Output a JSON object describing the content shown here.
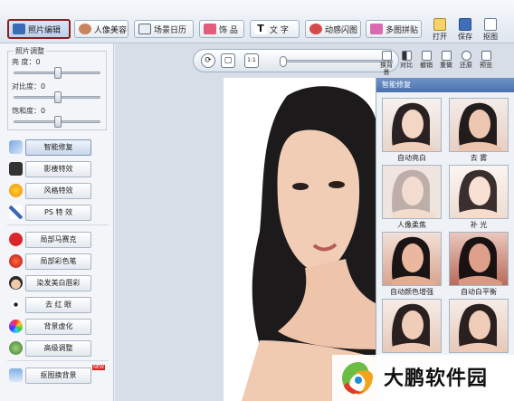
{
  "toolbar": {
    "tabs": [
      {
        "label": "照片编辑",
        "icon": "photo-edit-icon",
        "active": true
      },
      {
        "label": "人像美容",
        "icon": "portrait-icon",
        "active": false
      },
      {
        "label": "场景日历",
        "icon": "calendar-icon",
        "active": false
      },
      {
        "label": "饰 品",
        "icon": "accessory-icon",
        "active": false
      },
      {
        "label": "文 字",
        "icon": "text-icon",
        "active": false
      },
      {
        "label": "动感闪图",
        "icon": "animation-icon",
        "active": false
      },
      {
        "label": "多图拼贴",
        "icon": "collage-icon",
        "active": false
      }
    ],
    "right_buttons": [
      {
        "label": "打开",
        "icon": "open-icon"
      },
      {
        "label": "保存",
        "icon": "save-icon"
      },
      {
        "label": "抠图",
        "icon": "cutout-icon"
      }
    ]
  },
  "adjust": {
    "title": "照片调整",
    "brightness": {
      "label": "亮 度：",
      "value": "0",
      "level": 0.5
    },
    "contrast": {
      "label": "对比度：",
      "value": "0",
      "level": 0.5
    },
    "saturation": {
      "label": "饱和度：",
      "value": "0",
      "level": 0.5
    }
  },
  "tools": [
    {
      "label": "智能修复",
      "icon": "smart-repair-icon",
      "selected": true
    },
    {
      "label": "影楼特效",
      "icon": "studio-effect-icon",
      "selected": false
    },
    {
      "label": "风格特效",
      "icon": "style-effect-icon",
      "selected": false
    },
    {
      "label": "PS 特 效",
      "icon": "ps-effect-icon",
      "selected": false
    },
    {
      "label": "局部马赛克",
      "icon": "mosaic-icon",
      "selected": false
    },
    {
      "label": "局部彩色笔",
      "icon": "color-pen-icon",
      "selected": false
    },
    {
      "label": "染发美白唇彩",
      "icon": "hair-dye-icon",
      "selected": false
    },
    {
      "label": "去 红 眼",
      "icon": "red-eye-icon",
      "selected": false
    },
    {
      "label": "背景虚化",
      "icon": "blur-bg-icon",
      "selected": false
    },
    {
      "label": "高级调整",
      "icon": "advanced-adjust-icon",
      "selected": false
    },
    {
      "label": "抠图换背景",
      "icon": "cutout-bg-icon",
      "selected": false,
      "badge": "NEW"
    }
  ],
  "view_controls": {
    "rotate": "⟳",
    "fit": "▢",
    "actual": "1:1",
    "zoom_level": 0
  },
  "edit_tools": [
    {
      "label": "换背景",
      "icon": "change-bg-icon"
    },
    {
      "label": "对比",
      "icon": "compare-icon"
    },
    {
      "label": "撤销",
      "icon": "undo-icon"
    },
    {
      "label": "重做",
      "icon": "redo-icon"
    },
    {
      "label": "还原",
      "icon": "restore-icon"
    },
    {
      "label": "预览",
      "icon": "preview-icon"
    }
  ],
  "effects_panel": {
    "title": "智能修复",
    "items": [
      {
        "label": "自动亮白"
      },
      {
        "label": "去 雾"
      },
      {
        "label": "人像柔焦"
      },
      {
        "label": "补 光"
      },
      {
        "label": "自动颜色增强"
      },
      {
        "label": "自动白平衡"
      },
      {
        "label": ""
      },
      {
        "label": ""
      }
    ]
  },
  "watermark": {
    "text": "大鹏软件园"
  },
  "colors": {
    "active_tab_border": "#8b1d1d",
    "panel_header": "#4a72b0"
  }
}
